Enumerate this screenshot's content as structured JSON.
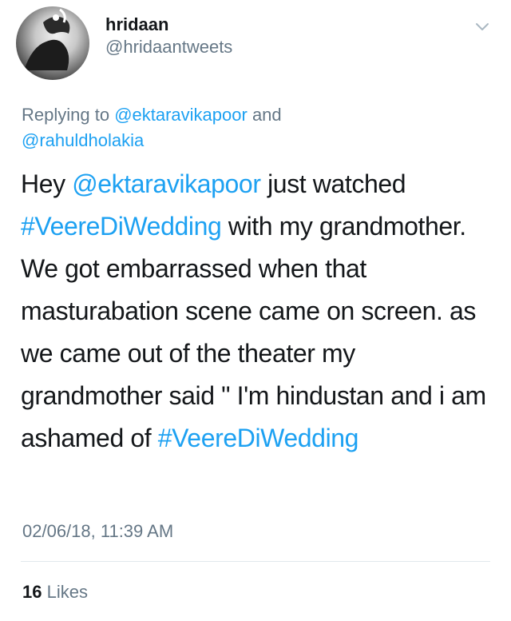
{
  "user": {
    "name": "hridaan",
    "handle": "@hridaantweets"
  },
  "reply": {
    "prefix": "Replying to ",
    "mention1": "@ektaravikapoor",
    "joiner": " and ",
    "mention2": "@rahuldholakia"
  },
  "tweet": {
    "p1": "Hey ",
    "mention": "@ektaravikapoor",
    "p2": " just watched ",
    "hashtag1": "#VeereDiWedding",
    "p3": " with my grandmother. We got embarrassed when that masturabation scene came on screen. as we came out of the theater my grandmother said \" I'm hindustan and i am ashamed of ",
    "hashtag2": "#VeereDiWedding"
  },
  "timestamp": "02/06/18, 11:39 AM",
  "stats": {
    "likes_count": "16",
    "likes_label": " Likes"
  },
  "colors": {
    "link": "#1da1f2",
    "secondary": "#657786",
    "primary": "#14171a"
  },
  "icons": {
    "menu": "chevron-down-icon"
  }
}
